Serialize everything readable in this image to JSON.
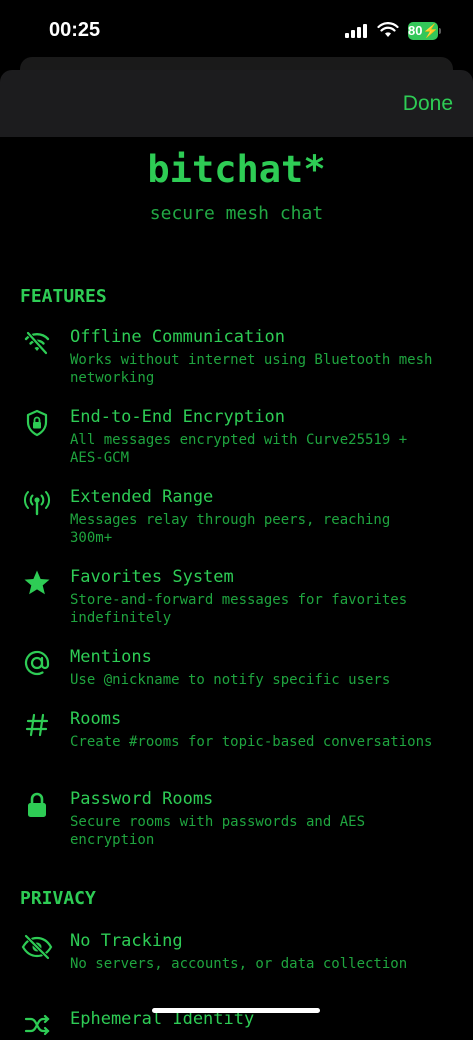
{
  "status": {
    "time": "00:25",
    "battery": "80"
  },
  "header": {
    "done_label": "Done"
  },
  "app": {
    "title": "bitchat*",
    "subtitle": "secure mesh chat"
  },
  "sections": {
    "features_title": "FEATURES",
    "privacy_title": "PRIVACY"
  },
  "features": [
    {
      "icon": "wifi-off-icon",
      "title": "Offline Communication",
      "desc": "Works without internet using Bluetooth mesh networking"
    },
    {
      "icon": "shield-lock-icon",
      "title": "End-to-End Encryption",
      "desc": "All messages encrypted with Curve25519 + AES-GCM"
    },
    {
      "icon": "antenna-icon",
      "title": "Extended Range",
      "desc": "Messages relay through peers, reaching 300m+"
    },
    {
      "icon": "star-icon",
      "title": "Favorites System",
      "desc": "Store-and-forward messages for favorites indefinitely"
    },
    {
      "icon": "at-icon",
      "title": "Mentions",
      "desc": "Use @nickname to notify specific users"
    },
    {
      "icon": "hash-icon",
      "title": "Rooms",
      "desc": "Create #rooms for topic-based conversations"
    },
    {
      "icon": "lock-icon",
      "title": "Password Rooms",
      "desc": "Secure rooms with passwords and AES encryption"
    }
  ],
  "privacy": [
    {
      "icon": "eye-slash-icon",
      "title": "No Tracking",
      "desc": "No servers, accounts, or data collection"
    },
    {
      "icon": "shuffle-icon",
      "title": "Ephemeral Identity",
      "desc": ""
    }
  ],
  "colors": {
    "accent": "#2ecc55",
    "background": "#000000",
    "header": "#1c1c1e"
  }
}
